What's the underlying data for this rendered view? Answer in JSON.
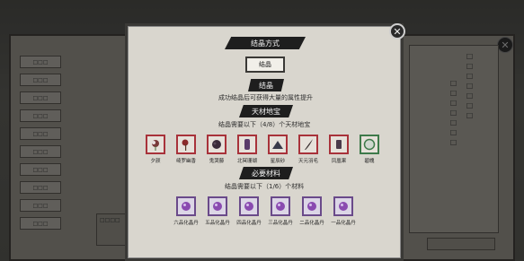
{
  "background": {
    "left_menu": [
      "□□□",
      "□□□",
      "□□□",
      "□□□",
      "□□□",
      "□□□",
      "□□□",
      "□□□",
      "□□□",
      "□□□"
    ],
    "right_vertical_text_1": "□□□□□□□",
    "right_vertical_text_2": "□□□□□□□",
    "bottom_left_text": "□□□□",
    "close_glyph": "✕"
  },
  "modal": {
    "title": "结晶方式",
    "action_button": "结晶",
    "section_crystal": {
      "header": "结晶",
      "description": "成功结晶后可获得大量的属性提升"
    },
    "section_treasure": {
      "header": "天材地宝",
      "requirement": "结晶需要以下（4/8）个天材地宝",
      "items": [
        {
          "label": "夕颜",
          "icon": "flower-icon",
          "color": "#a8323a"
        },
        {
          "label": "绮罗幽香",
          "icon": "vine-icon",
          "color": "#a8323a"
        },
        {
          "label": "鬼哭藤",
          "icon": "root-icon",
          "color": "#a8323a"
        },
        {
          "label": "北冥珊瑚",
          "icon": "coral-icon",
          "color": "#a8323a"
        },
        {
          "label": "星辰砂",
          "icon": "sand-icon",
          "color": "#a8323a"
        },
        {
          "label": "天元羽毛",
          "icon": "feather-icon",
          "color": "#a8323a"
        },
        {
          "label": "凤凰果",
          "icon": "fruit-icon",
          "color": "#a8323a"
        },
        {
          "label": "碧魄",
          "icon": "orb-icon",
          "color": "#3e7a4a"
        }
      ]
    },
    "section_materials": {
      "header": "必要材料",
      "requirement": "结晶需要以下（1/6）个材料",
      "items": [
        {
          "label": "六品化晶丹",
          "icon": "pill-icon"
        },
        {
          "label": "五品化晶丹",
          "icon": "pill-icon"
        },
        {
          "label": "四品化晶丹",
          "icon": "pill-icon"
        },
        {
          "label": "三品化晶丹",
          "icon": "pill-icon"
        },
        {
          "label": "二品化晶丹",
          "icon": "pill-icon"
        },
        {
          "label": "一品化晶丹",
          "icon": "pill-icon"
        }
      ]
    },
    "close_glyph": "✕"
  }
}
